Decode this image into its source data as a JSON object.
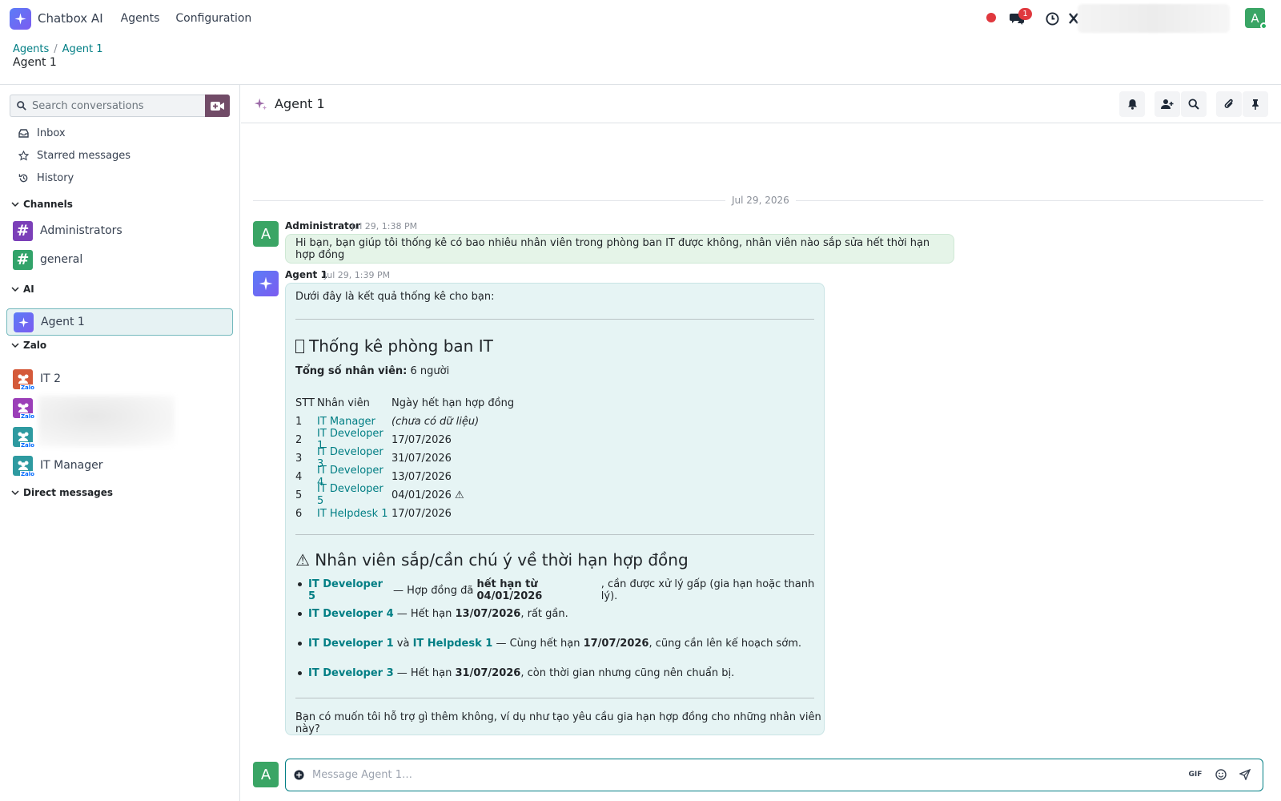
{
  "app": {
    "title": "Chatbox AI",
    "nav": [
      "Agents",
      "Configuration"
    ],
    "notification_count": "1",
    "user_initial": "A"
  },
  "breadcrumb": {
    "root": "Agents",
    "current": "Agent 1",
    "page_title": "Agent 1"
  },
  "sidebar": {
    "search_placeholder": "Search conversations",
    "links": [
      "Inbox",
      "Starred messages",
      "History"
    ],
    "categories": {
      "channels": "Channels",
      "ai": "AI",
      "zalo": "Zalo",
      "dm": "Direct messages"
    },
    "channels": [
      {
        "name": "Administrators",
        "color": "#7b3fb8"
      },
      {
        "name": "general",
        "color": "#32a36a"
      }
    ],
    "ai_agents": [
      {
        "name": "Agent 1"
      }
    ],
    "zalo": [
      {
        "name": "IT 2",
        "color": "#d45a3a"
      },
      {
        "name": "",
        "color": "#9b3fb8"
      },
      {
        "name": "",
        "color": "#2e9aa0"
      },
      {
        "name": "IT Manager",
        "color": "#2e9aa0"
      }
    ],
    "zalo_tag": "Zalo"
  },
  "chat": {
    "title": "Agent 1",
    "date": "Jul 29, 2026",
    "messages": [
      {
        "author": "Administrator",
        "author_initial": "A",
        "time": "Jul 29, 1:38 PM",
        "text": "Hi bạn, bạn giúp tôi thống kê có bao nhiêu nhân viên trong phòng ban IT được không, nhân viên nào sắp sửa hết thời hạn hợp đồng"
      },
      {
        "author": "Agent 1",
        "time": "Jul 29, 1:39 PM",
        "intro": "Dưới đây là kết quả thống kê cho bạn:",
        "heading1": "Thống kê phòng ban IT",
        "heading1_icon": "",
        "total_label": "Tổng số nhân viên:",
        "total_value": "6 người",
        "table": {
          "headers": [
            "STT",
            "Nhân viên",
            "Ngày hết hạn hợp đồng"
          ],
          "rows": [
            [
              "1",
              "IT Manager",
              "(chưa có dữ liệu)"
            ],
            [
              "2",
              "IT Developer 1",
              "17/07/2026"
            ],
            [
              "3",
              "IT Developer 3",
              "31/07/2026"
            ],
            [
              "4",
              "IT Developer 4",
              "13/07/2026"
            ],
            [
              "5",
              "IT Developer 5",
              "04/01/2026 ⚠"
            ],
            [
              "6",
              "IT Helpdesk 1",
              "17/07/2026"
            ]
          ]
        },
        "heading2": "⚠ Nhân viên sắp/cần chú ý về thời hạn hợp đồng",
        "bullets": [
          {
            "a": "IT Developer 5",
            "b": " — Hợp đồng đã ",
            "c": "hết hạn từ 04/01/2026",
            "d": ", cần được xử lý gấp (gia hạn hoặc thanh lý)."
          },
          {
            "a": "IT Developer 4",
            "b": " — Hết hạn ",
            "c": "13/07/2026",
            "d": ", rất gần."
          },
          {
            "a": "IT Developer 1",
            "mid": " và ",
            "a2": "IT Helpdesk 1",
            "b": " — Cùng hết hạn ",
            "c": "17/07/2026",
            "d": ", cũng cần lên kế hoạch sớm."
          },
          {
            "a": "IT Developer 3",
            "b": " — Hết hạn ",
            "c": "31/07/2026",
            "d": ", còn thời gian nhưng cũng nên chuẩn bị."
          }
        ],
        "outro": "Bạn có muốn tôi hỗ trợ gì thêm không, ví dụ như tạo yêu cầu gia hạn hợp đồng cho những nhân viên này?"
      }
    ],
    "composer_placeholder": "Message Agent 1…",
    "gif_label": "GIF"
  }
}
